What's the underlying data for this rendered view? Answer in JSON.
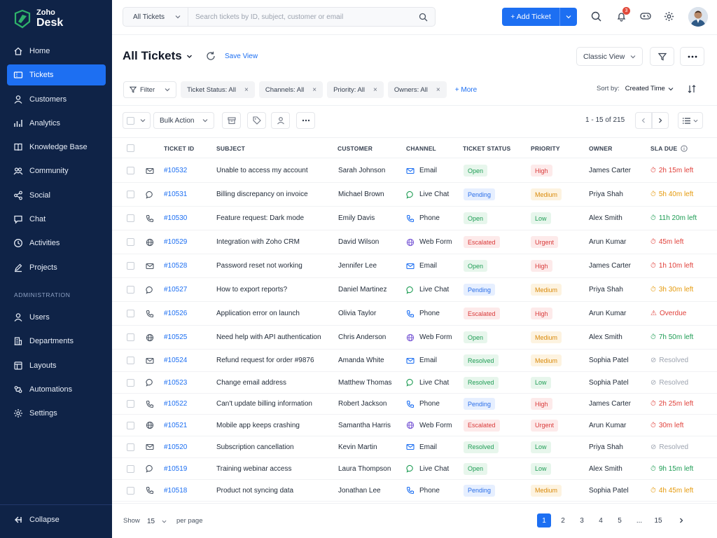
{
  "brand": {
    "zoho": "Zoho",
    "desk": "Desk"
  },
  "sidebar": {
    "items": [
      {
        "label": "Home",
        "icon": "home-icon"
      },
      {
        "label": "Tickets",
        "icon": "ticket-icon",
        "active": true
      },
      {
        "label": "Customers",
        "icon": "user-icon"
      },
      {
        "label": "Analytics",
        "icon": "analytics-icon"
      },
      {
        "label": "Knowledge Base",
        "icon": "book-icon"
      },
      {
        "label": "Community",
        "icon": "community-icon"
      },
      {
        "label": "Social",
        "icon": "share-icon"
      },
      {
        "label": "Chat",
        "icon": "chat-icon"
      },
      {
        "label": "Activities",
        "icon": "clock-icon"
      },
      {
        "label": "Projects",
        "icon": "pen-icon"
      }
    ],
    "admin_label": "ADMINISTRATION",
    "admin_items": [
      {
        "label": "Users",
        "icon": "user-icon"
      },
      {
        "label": "Departments",
        "icon": "building-icon"
      },
      {
        "label": "Layouts",
        "icon": "layout-icon"
      },
      {
        "label": "Automations",
        "icon": "automation-icon"
      },
      {
        "label": "Settings",
        "icon": "gear-icon"
      }
    ],
    "collapse_label": "Collapse"
  },
  "header": {
    "search_scope": "All Tickets",
    "search_placeholder": "Search tickets by ID, subject, customer or email",
    "add_ticket_label": "+ Add Ticket",
    "notification_count": "3"
  },
  "page": {
    "title": "All Tickets",
    "save_view": "Save View",
    "view_mode": "Classic View"
  },
  "filters": {
    "filter_label": "Filter",
    "chips": [
      "Ticket Status: All",
      "Channels: All",
      "Priority: All",
      "Owners: All"
    ],
    "more_label": "+ More",
    "sort_by_label": "Sort by:",
    "sort_value": "Created Time"
  },
  "actions": {
    "bulk_action": "Bulk Action",
    "range": "1 - 15 of 215"
  },
  "table": {
    "columns": [
      "TICKET ID",
      "SUBJECT",
      "CUSTOMER",
      "CHANNEL",
      "TICKET STATUS",
      "PRIORITY",
      "OWNER",
      "SLA DUE"
    ],
    "rows": [
      {
        "id": "#10532",
        "subject": "Unable to access my account",
        "customer": "Sarah Johnson",
        "channel": "Email",
        "status": "Open",
        "priority": "High",
        "owner": "James Carter",
        "sla": "2h 15m left",
        "sla_kind": "red"
      },
      {
        "id": "#10531",
        "subject": "Billing discrepancy on invoice",
        "customer": "Michael Brown",
        "channel": "Live Chat",
        "status": "Pending",
        "priority": "Medium",
        "owner": "Priya Shah",
        "sla": "5h 40m left",
        "sla_kind": "orange"
      },
      {
        "id": "#10530",
        "subject": "Feature request: Dark mode",
        "customer": "Emily Davis",
        "channel": "Phone",
        "status": "Open",
        "priority": "Low",
        "owner": "Alex Smith",
        "sla": "11h 20m left",
        "sla_kind": "green"
      },
      {
        "id": "#10529",
        "subject": "Integration with Zoho CRM",
        "customer": "David Wilson",
        "channel": "Web Form",
        "status": "Escalated",
        "priority": "Urgent",
        "owner": "Arun Kumar",
        "sla": "45m left",
        "sla_kind": "red"
      },
      {
        "id": "#10528",
        "subject": "Password reset not working",
        "customer": "Jennifer Lee",
        "channel": "Email",
        "status": "Open",
        "priority": "High",
        "owner": "James Carter",
        "sla": "1h 10m left",
        "sla_kind": "red"
      },
      {
        "id": "#10527",
        "subject": "How to export reports?",
        "customer": "Daniel Martinez",
        "channel": "Live Chat",
        "status": "Pending",
        "priority": "Medium",
        "owner": "Priya Shah",
        "sla": "3h 30m left",
        "sla_kind": "orange"
      },
      {
        "id": "#10526",
        "subject": "Application error on launch",
        "customer": "Olivia Taylor",
        "channel": "Phone",
        "status": "Escalated",
        "priority": "High",
        "owner": "Arun Kumar",
        "sla": "Overdue",
        "sla_kind": "overdue"
      },
      {
        "id": "#10525",
        "subject": "Need help with API authentication",
        "customer": "Chris Anderson",
        "channel": "Web Form",
        "status": "Open",
        "priority": "Medium",
        "owner": "Alex Smith",
        "sla": "7h 50m left",
        "sla_kind": "green"
      },
      {
        "id": "#10524",
        "subject": "Refund request for order #9876",
        "customer": "Amanda White",
        "channel": "Email",
        "status": "Resolved",
        "priority": "Medium",
        "owner": "Sophia Patel",
        "sla": "Resolved",
        "sla_kind": "gray"
      },
      {
        "id": "#10523",
        "subject": "Change email address",
        "customer": "Matthew Thomas",
        "channel": "Live Chat",
        "status": "Resolved",
        "priority": "Low",
        "owner": "Sophia Patel",
        "sla": "Resolved",
        "sla_kind": "gray"
      },
      {
        "id": "#10522",
        "subject": "Can't update billing information",
        "customer": "Robert Jackson",
        "channel": "Phone",
        "status": "Pending",
        "priority": "High",
        "owner": "James Carter",
        "sla": "2h 25m left",
        "sla_kind": "red"
      },
      {
        "id": "#10521",
        "subject": "Mobile app keeps crashing",
        "customer": "Samantha Harris",
        "channel": "Web Form",
        "status": "Escalated",
        "priority": "Urgent",
        "owner": "Arun Kumar",
        "sla": "30m left",
        "sla_kind": "red"
      },
      {
        "id": "#10520",
        "subject": "Subscription cancellation",
        "customer": "Kevin Martin",
        "channel": "Email",
        "status": "Resolved",
        "priority": "Low",
        "owner": "Priya Shah",
        "sla": "Resolved",
        "sla_kind": "gray"
      },
      {
        "id": "#10519",
        "subject": "Training webinar access",
        "customer": "Laura Thompson",
        "channel": "Live Chat",
        "status": "Open",
        "priority": "Low",
        "owner": "Alex Smith",
        "sla": "9h 15m left",
        "sla_kind": "green"
      },
      {
        "id": "#10518",
        "subject": "Product not syncing data",
        "customer": "Jonathan Lee",
        "channel": "Phone",
        "status": "Pending",
        "priority": "Medium",
        "owner": "Sophia Patel",
        "sla": "4h 45m left",
        "sla_kind": "orange"
      }
    ]
  },
  "footer": {
    "show_label": "Show",
    "per_page_value": "15",
    "per_page_label": "per page",
    "pages": [
      "1",
      "2",
      "3",
      "4",
      "5",
      "...",
      "15"
    ],
    "current_page": "1"
  },
  "colors": {
    "sidebar_bg": "#0f2347",
    "accent": "#1d6ff2"
  }
}
